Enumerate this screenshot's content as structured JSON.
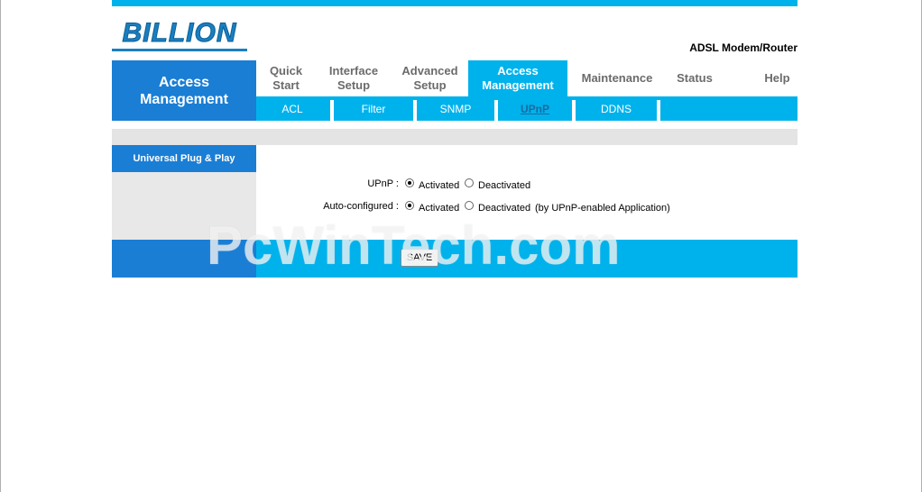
{
  "brand": {
    "logo_text": "BILLION",
    "product_name": "ADSL Modem/Router"
  },
  "section_title": "Access Management",
  "main_nav": [
    {
      "label": "Quick Start",
      "active": false
    },
    {
      "label": "Interface Setup",
      "active": false
    },
    {
      "label": "Advanced Setup",
      "active": false
    },
    {
      "label": "Access Management",
      "active": true
    },
    {
      "label": "Maintenance",
      "active": false
    },
    {
      "label": "Status",
      "active": false
    },
    {
      "label": "Help",
      "active": false
    }
  ],
  "sub_nav": [
    {
      "label": "ACL",
      "active": false
    },
    {
      "label": "Filter",
      "active": false
    },
    {
      "label": "SNMP",
      "active": false
    },
    {
      "label": "UPnP",
      "active": true
    },
    {
      "label": "DDNS",
      "active": false
    }
  ],
  "side_heading": "Universal Plug & Play",
  "form": {
    "upnp": {
      "label": "UPnP :",
      "options": [
        "Activated",
        "Deactivated"
      ],
      "selected": "Activated"
    },
    "auto_configured": {
      "label": "Auto-configured :",
      "options": [
        "Activated",
        "Deactivated"
      ],
      "selected": "Activated",
      "note": "(by UPnP-enabled Application)"
    }
  },
  "save_label": "SAVE",
  "watermark": "PcWinTech.com",
  "colors": {
    "accent_blue": "#1a7ed5",
    "cyan": "#00b2ec",
    "grey": "#e4e4e4"
  }
}
